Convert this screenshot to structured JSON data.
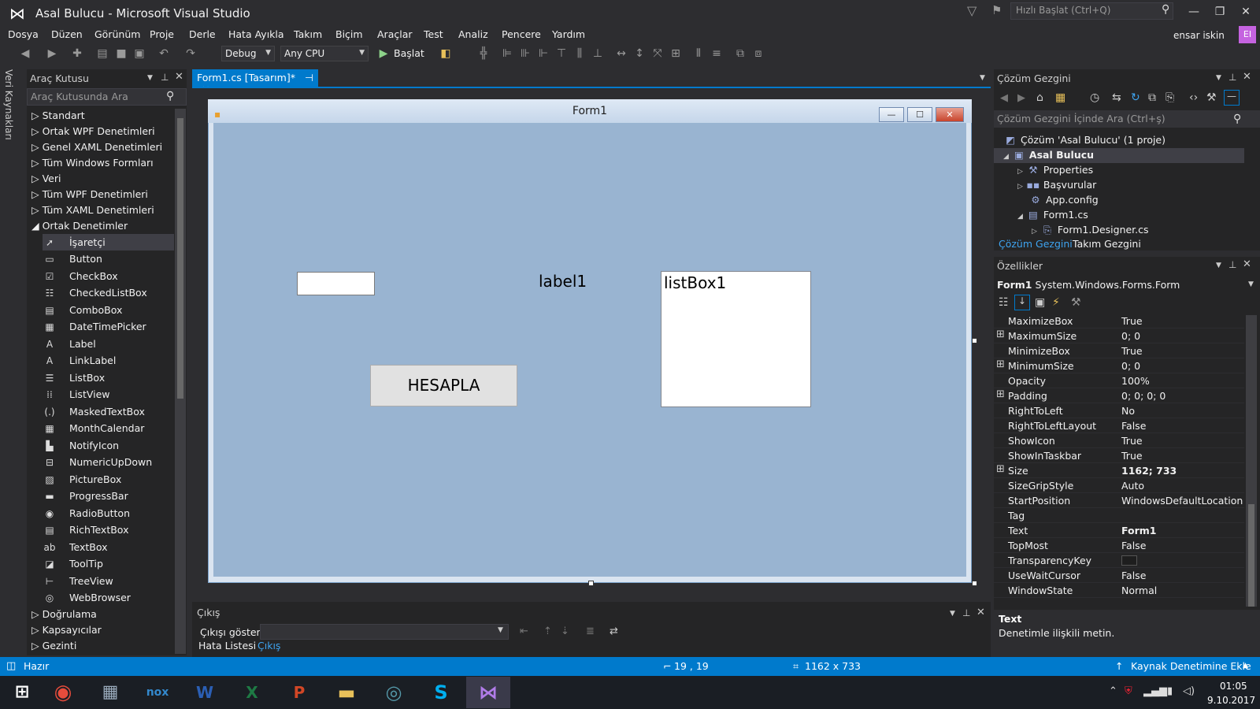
{
  "window": {
    "title": "Asal Bulucu - Microsoft Visual Studio",
    "quick_launch_placeholder": "Hızlı Başlat (Ctrl+Q)",
    "user_name": "ensar iskin",
    "user_initials": "EI"
  },
  "menu": [
    "Dosya",
    "Düzen",
    "Görünüm",
    "Proje",
    "Derle",
    "Hata Ayıkla",
    "Takım",
    "Biçim",
    "Araçlar",
    "Test",
    "Analiz",
    "Pencere",
    "Yardım"
  ],
  "toolbar": {
    "config": "Debug",
    "platform": "Any CPU",
    "start_label": "Başlat"
  },
  "side_strip_label": "Veri Kaynakları",
  "toolbox": {
    "title": "Araç Kutusu",
    "search_placeholder": "Araç Kutusunda Ara",
    "categories_top": [
      "Standart",
      "Ortak WPF Denetimleri",
      "Genel XAML Denetimleri",
      "Tüm Windows Formları",
      "Veri",
      "Tüm WPF Denetimleri",
      "Tüm XAML Denetimleri"
    ],
    "expanded_category": "Ortak Denetimler",
    "tools": [
      "İşaretçi",
      "Button",
      "CheckBox",
      "CheckedListBox",
      "ComboBox",
      "DateTimePicker",
      "Label",
      "LinkLabel",
      "ListBox",
      "ListView",
      "MaskedTextBox",
      "MonthCalendar",
      "NotifyIcon",
      "NumericUpDown",
      "PictureBox",
      "ProgressBar",
      "RadioButton",
      "RichTextBox",
      "TextBox",
      "ToolTip",
      "TreeView",
      "WebBrowser"
    ],
    "categories_bottom": [
      "Doğrulama",
      "Kapsayıcılar",
      "Gezinti"
    ]
  },
  "document": {
    "tab_label": "Form1.cs [Tasarım]*",
    "form_title": "Form1",
    "label_text": "label1",
    "listbox_text": "listBox1",
    "button_text": "HESAPLA"
  },
  "output": {
    "title": "Çıkış",
    "show_label": "Çıkışı göster:",
    "tabs": [
      "Hata Listesi",
      "Çıkış"
    ]
  },
  "solution_explorer": {
    "title": "Çözüm Gezgini",
    "search_placeholder": "Çözüm Gezgini İçinde Ara (Ctrl+ş)",
    "items": [
      {
        "label": "Çözüm 'Asal Bulucu' (1 proje)"
      },
      {
        "label": "Asal Bulucu"
      },
      {
        "label": "Properties"
      },
      {
        "label": "Başvurular"
      },
      {
        "label": "App.config"
      },
      {
        "label": "Form1.cs"
      },
      {
        "label": "Form1.Designer.cs"
      }
    ],
    "tabs": [
      "Çözüm Gezgini",
      "Takım Gezgini"
    ]
  },
  "properties": {
    "title": "Özellikler",
    "object_name": "Form1",
    "object_type": "System.Windows.Forms.Form",
    "rows": [
      {
        "name": "MaximizeBox",
        "value": "True",
        "expand": ""
      },
      {
        "name": "MaximumSize",
        "value": "0; 0",
        "expand": "⊞"
      },
      {
        "name": "MinimizeBox",
        "value": "True",
        "expand": ""
      },
      {
        "name": "MinimumSize",
        "value": "0; 0",
        "expand": "⊞"
      },
      {
        "name": "Opacity",
        "value": "100%",
        "expand": ""
      },
      {
        "name": "Padding",
        "value": "0; 0; 0; 0",
        "expand": "⊞"
      },
      {
        "name": "RightToLeft",
        "value": "No",
        "expand": ""
      },
      {
        "name": "RightToLeftLayout",
        "value": "False",
        "expand": ""
      },
      {
        "name": "ShowIcon",
        "value": "True",
        "expand": ""
      },
      {
        "name": "ShowInTaskbar",
        "value": "True",
        "expand": ""
      },
      {
        "name": "Size",
        "value": "1162; 733",
        "expand": "⊞"
      },
      {
        "name": "SizeGripStyle",
        "value": "Auto",
        "expand": ""
      },
      {
        "name": "StartPosition",
        "value": "WindowsDefaultLocation",
        "expand": ""
      },
      {
        "name": "Tag",
        "value": "",
        "expand": ""
      },
      {
        "name": "Text",
        "value": "Form1",
        "expand": ""
      },
      {
        "name": "TopMost",
        "value": "False",
        "expand": ""
      },
      {
        "name": "TransparencyKey",
        "value": "",
        "expand": ""
      },
      {
        "name": "UseWaitCursor",
        "value": "False",
        "expand": ""
      },
      {
        "name": "WindowState",
        "value": "Normal",
        "expand": ""
      }
    ],
    "desc_title": "Text",
    "desc_text": "Denetimle ilişkili metin."
  },
  "status": {
    "ready": "Hazır",
    "position": "19 , 19",
    "size": "1162 x 733",
    "source_control": "Kaynak Denetimine Ekle"
  },
  "taskbar": {
    "time": "01:05",
    "date": "9.10.2017"
  },
  "colors": {
    "accent": "#007acc",
    "form_back": "#99b4d1"
  }
}
